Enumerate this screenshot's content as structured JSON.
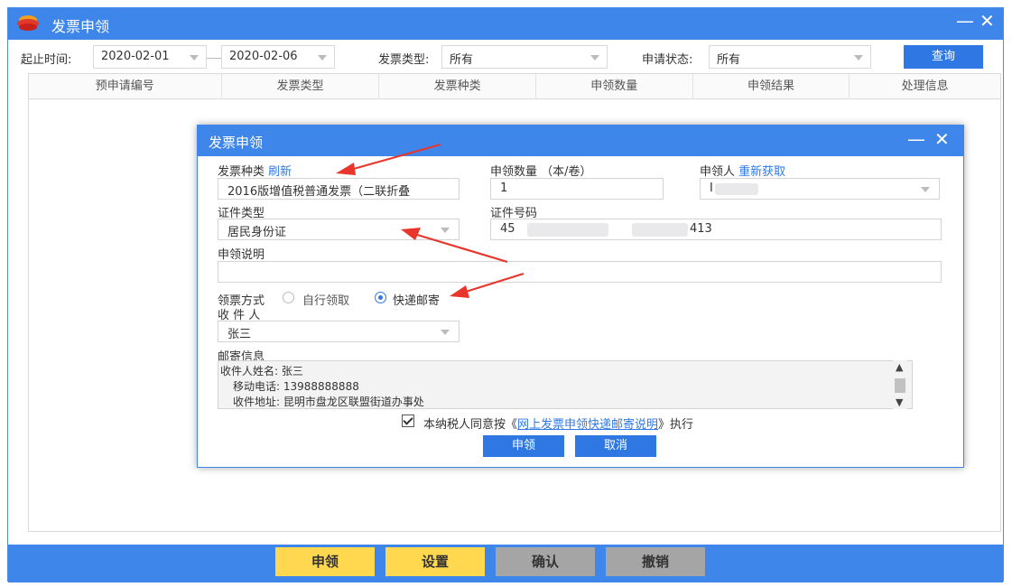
{
  "window": {
    "title": "发票申领",
    "minimize": "—",
    "close": "✕"
  },
  "filters": {
    "start_label": "起止时间:",
    "start_date": "2020-02-01",
    "end_date": "2020-02-06",
    "type_label": "发票类型:",
    "type_value": "所有",
    "status_label": "申请状态:",
    "status_value": "所有",
    "query_button": "查询"
  },
  "table": {
    "columns": [
      "预申请编号",
      "发票类型",
      "发票种类",
      "申领数量",
      "申领结果",
      "处理信息"
    ]
  },
  "bottombar": {
    "apply": "申领",
    "settings": "设置",
    "confirm": "确认",
    "revoke": "撤销"
  },
  "dialog": {
    "title": "发票申领",
    "minimize": "—",
    "close": "✕",
    "kind_label": "发票种类",
    "kind_refresh": "刷新",
    "kind_value": "2016版增值税普通发票（二联折叠",
    "qty_label": "申领数量 （本/卷）",
    "qty_value": "1",
    "applicant_label": "申领人",
    "applicant_refresh": "重新获取",
    "applicant_value": "I",
    "id_type_label": "证件类型",
    "id_type_value": "居民身份证",
    "id_no_label": "证件号码",
    "id_no_prefix": "45",
    "id_no_suffix": "413",
    "note_label": "申领说明",
    "note_value": "",
    "method_label": "领票方式",
    "method_self": "自行领取",
    "method_express": "快递邮寄",
    "method_selected": "快递邮寄",
    "recipient_label": "收 件 人",
    "recipient_value": "张三",
    "mail_label": "邮寄信息",
    "mail_lines": [
      "收件人姓名: 张三",
      "移动电话: 13988888888",
      "收件地址: 昆明市盘龙区联盟街道办事处"
    ],
    "agree_prefix": "本纳税人同意按《",
    "agree_link": "网上发票申领快递邮寄说明",
    "agree_suffix": "》执行",
    "apply_button": "申领",
    "cancel_button": "取消"
  },
  "colors": {
    "titlebar": "#3e86ea",
    "primary_button": "#2f78e4",
    "yellow_button": "#ffd84f",
    "gray_button": "#a5a5a5",
    "annotation_arrow": "#e8362c"
  }
}
